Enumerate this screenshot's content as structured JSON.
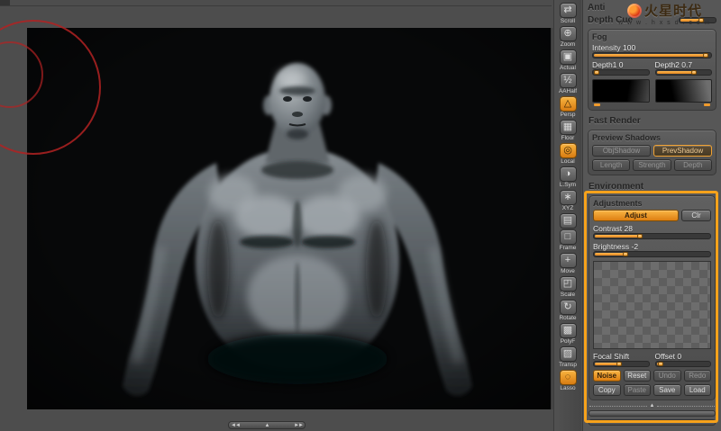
{
  "watermark": {
    "brand": "火星时代",
    "site": "w w w . h x s d . c o m"
  },
  "toolstrip": {
    "items": [
      {
        "label": "Scroll",
        "glyph": "⇄",
        "active": false
      },
      {
        "label": "Zoom",
        "glyph": "⊕",
        "active": false
      },
      {
        "label": "Actual",
        "glyph": "▣",
        "active": false
      },
      {
        "label": "AAHalf",
        "glyph": "½",
        "active": false
      },
      {
        "label": "Persp",
        "glyph": "△",
        "active": true
      },
      {
        "label": "Floor",
        "glyph": "▦",
        "active": false
      },
      {
        "label": "Local",
        "glyph": "◎",
        "active": true
      },
      {
        "label": "L.Sym",
        "glyph": "◑",
        "active": false
      },
      {
        "label": "XYZ",
        "glyph": "∗",
        "active": false
      },
      {
        "label": "",
        "glyph": "▤",
        "active": false
      },
      {
        "label": "Frame",
        "glyph": "□",
        "active": false
      },
      {
        "label": "Move",
        "glyph": "+",
        "active": false
      },
      {
        "label": "Scale",
        "glyph": "◰",
        "active": false
      },
      {
        "label": "Rotate",
        "glyph": "↻",
        "active": false
      },
      {
        "label": "PolyF",
        "glyph": "▩",
        "active": false
      },
      {
        "label": "Transp",
        "glyph": "▨",
        "active": false
      },
      {
        "label": "Lasso",
        "glyph": "◌",
        "active": true
      }
    ]
  },
  "panel": {
    "antialias_label": "Anti",
    "depth_cue_label": "Depth Cue",
    "fog": {
      "title": "Fog",
      "intensity": "Intensity 100",
      "depth1": "Depth1 0",
      "depth2": "Depth2 0.7"
    },
    "fast_render": "Fast Render",
    "preview_shadows": {
      "title": "Preview Shadows",
      "obj_shadow": "ObjShadow",
      "prev_shadow": "PrevShadow",
      "sub": [
        "Length",
        "Strength",
        "Depth"
      ]
    },
    "environment": "Environment",
    "adjustments": {
      "title": "Adjustments",
      "adjust": "Adjust",
      "clr": "Clr",
      "contrast": "Contrast 28",
      "brightness": "Brightness -2",
      "focal_shift": "Focal Shift",
      "offset": "Offset 0",
      "noise": "Noise",
      "reset": "Reset",
      "undo": "Undo",
      "redo": "Redo",
      "copy": "Copy",
      "paste": "Paste",
      "save": "Save",
      "load": "Load",
      "collapse_glyph": "▲"
    }
  },
  "scrollbar": {
    "left": "◄◄",
    "mid": "▲",
    "right": "►►"
  },
  "colors": {
    "accent": "#f29b2a",
    "annotation": "#f7a21b",
    "red_arc": "#b22222",
    "panel_bg": "#575757",
    "viewport_bg": "#0a0b0c"
  }
}
